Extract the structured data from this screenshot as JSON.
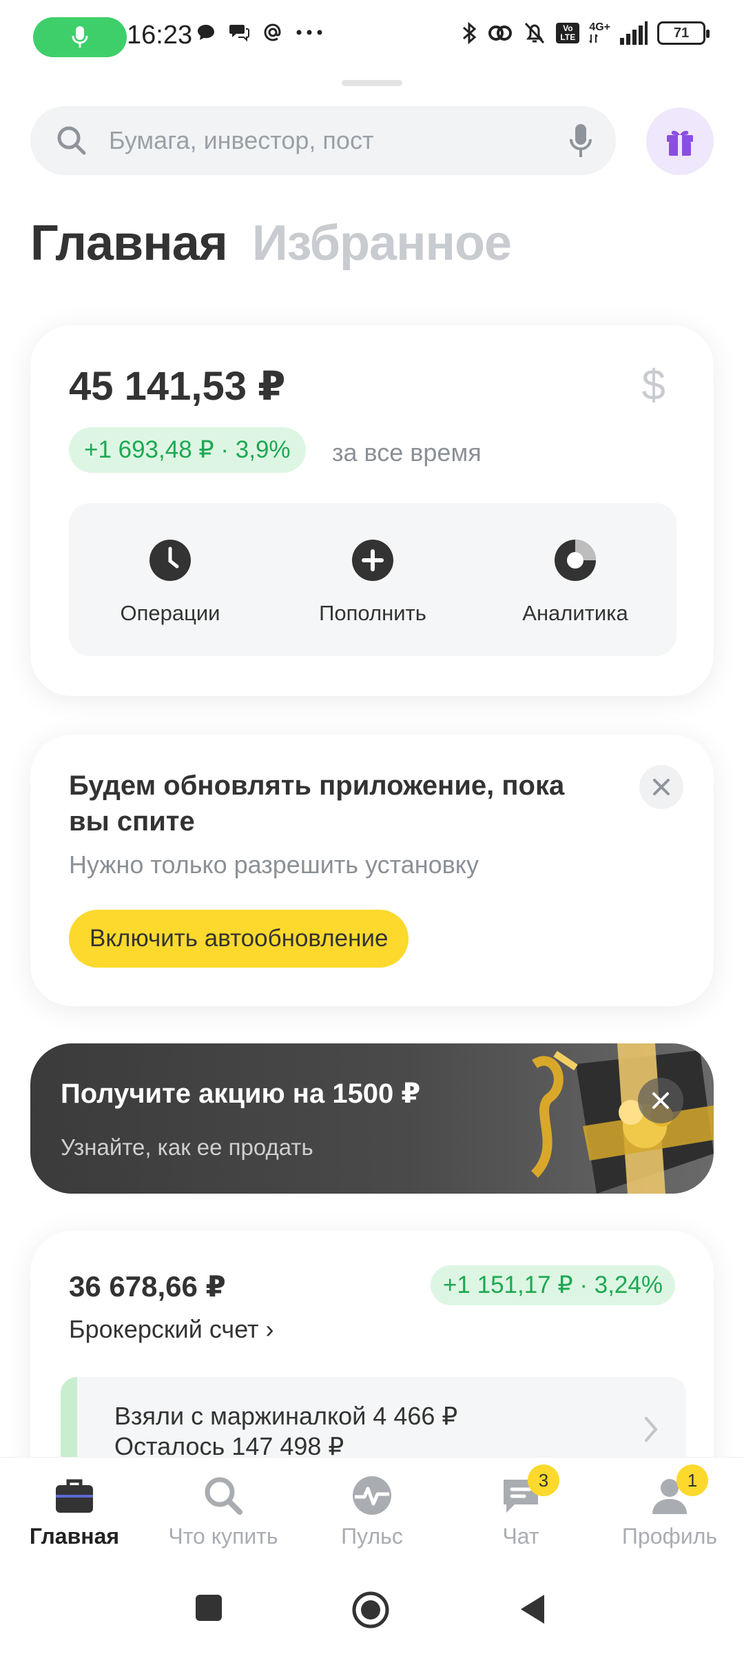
{
  "status_bar": {
    "time": "16:23",
    "battery": "71",
    "network": "4G+",
    "volte": "Vo LTE"
  },
  "search": {
    "placeholder": "Бумага, инвестор, пост"
  },
  "tabs": [
    {
      "label": "Главная",
      "active": true
    },
    {
      "label": "Избранное",
      "active": false
    }
  ],
  "portfolio": {
    "balance": "45 141,53 ₽",
    "currency_symbol": "$",
    "gain": "+1 693,48 ₽ · 3,9%",
    "period": "за все время",
    "actions": [
      {
        "label": "Операции",
        "icon": "clock-icon"
      },
      {
        "label": "Пополнить",
        "icon": "plus-circle-icon"
      },
      {
        "label": "Аналитика",
        "icon": "pie-chart-icon"
      }
    ]
  },
  "update_banner": {
    "title": "Будем обновлять приложение, пока вы спите",
    "subtitle": "Нужно только разрешить установку",
    "button": "Включить автообновление"
  },
  "promo": {
    "title": "Получите акцию на 1500 ₽",
    "subtitle": "Узнайте, как ее продать"
  },
  "account": {
    "amount": "36 678,66 ₽",
    "gain": "+1 151,17 ₽ · 3,24%",
    "name": "Брокерский счет ›",
    "margin_line1": "Взяли с маржиналкой 4 466 ₽",
    "margin_line2": "Осталось 147 498 ₽"
  },
  "bottom_nav": [
    {
      "label": "Главная",
      "icon": "briefcase-icon",
      "active": true,
      "badge": ""
    },
    {
      "label": "Что купить",
      "icon": "search-icon",
      "active": false,
      "badge": ""
    },
    {
      "label": "Пульс",
      "icon": "pulse-icon",
      "active": false,
      "badge": ""
    },
    {
      "label": "Чат",
      "icon": "chat-icon",
      "active": false,
      "badge": "3"
    },
    {
      "label": "Профиль",
      "icon": "profile-icon",
      "active": false,
      "badge": "1"
    }
  ],
  "colors": {
    "accent_yellow": "#fcd92c",
    "gain_green": "#1ea853",
    "gain_bg": "#ddf6e3",
    "mic_green": "#3ecf6a",
    "gift_bg": "#efe7fb"
  }
}
